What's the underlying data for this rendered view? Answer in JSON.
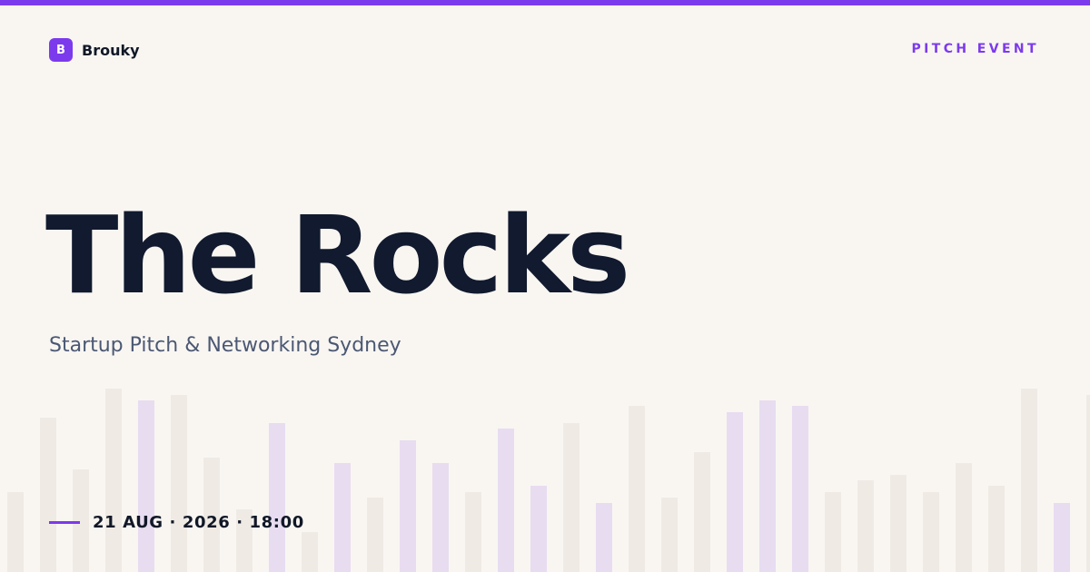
{
  "brand": {
    "logo_letter": "B",
    "name": "Brouky"
  },
  "event_tag": "PITCH EVENT",
  "title": "The Rocks",
  "subtitle": "Startup Pitch & Networking Sydney",
  "date": {
    "text": "21 AUG · 2026 · 18:00"
  },
  "colors": {
    "accent": "#7c3aed",
    "background": "#f9f6f2",
    "title": "#111a2e",
    "subtitle": "#4b5873",
    "bar_neutral": "#efeae4",
    "bar_accent": "#e8dcf1"
  },
  "decor_bars": [
    {
      "level": 0.14,
      "accent": false
    },
    {
      "level": 0.27,
      "accent": false
    },
    {
      "level": 0.18,
      "accent": false
    },
    {
      "level": 0.32,
      "accent": false
    },
    {
      "level": 0.3,
      "accent": true
    },
    {
      "level": 0.31,
      "accent": false
    },
    {
      "level": 0.2,
      "accent": false
    },
    {
      "level": 0.11,
      "accent": false
    },
    {
      "level": 0.26,
      "accent": true
    },
    {
      "level": 0.07,
      "accent": false
    },
    {
      "level": 0.19,
      "accent": true
    },
    {
      "level": 0.13,
      "accent": false
    },
    {
      "level": 0.23,
      "accent": true
    },
    {
      "level": 0.19,
      "accent": true
    },
    {
      "level": 0.14,
      "accent": false
    },
    {
      "level": 0.25,
      "accent": true
    },
    {
      "level": 0.15,
      "accent": true
    },
    {
      "level": 0.26,
      "accent": false
    },
    {
      "level": 0.12,
      "accent": true
    },
    {
      "level": 0.29,
      "accent": false
    },
    {
      "level": 0.13,
      "accent": false
    },
    {
      "level": 0.21,
      "accent": false
    },
    {
      "level": 0.28,
      "accent": true
    },
    {
      "level": 0.3,
      "accent": true
    },
    {
      "level": 0.29,
      "accent": true
    },
    {
      "level": 0.14,
      "accent": false
    },
    {
      "level": 0.16,
      "accent": false
    },
    {
      "level": 0.17,
      "accent": false
    },
    {
      "level": 0.14,
      "accent": false
    },
    {
      "level": 0.19,
      "accent": false
    },
    {
      "level": 0.15,
      "accent": false
    },
    {
      "level": 0.32,
      "accent": false
    },
    {
      "level": 0.12,
      "accent": true
    },
    {
      "level": 0.31,
      "accent": false
    }
  ]
}
